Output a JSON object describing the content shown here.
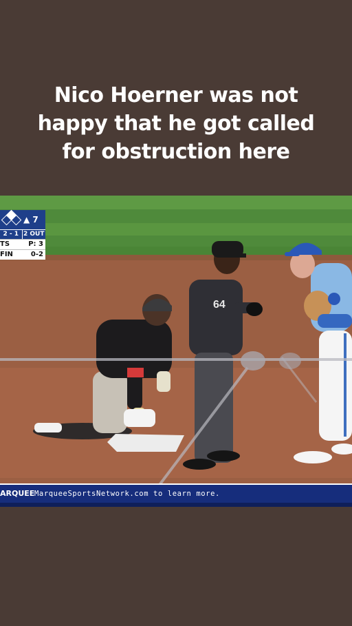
{
  "caption": {
    "text": "Nico Hoerner was not\nhappy that he got called\nfor obstruction here"
  },
  "scorebug": {
    "inning": "▲ 7",
    "count": "2 - 1",
    "outs": "2 OUT",
    "row1_team": "TS",
    "row1_value": "P: 3",
    "row2_team": "FIN",
    "row2_value": "0-2"
  },
  "umpire": {
    "number": "64"
  },
  "ticker": {
    "left_text": "ARQUEE",
    "right_text": "MarqueeSportsNetwork.com to learn more."
  },
  "colors": {
    "background": "#4a3b35",
    "network_blue": "#162d7c",
    "grass": "#4f8a3b",
    "dirt": "#9b5f43"
  }
}
